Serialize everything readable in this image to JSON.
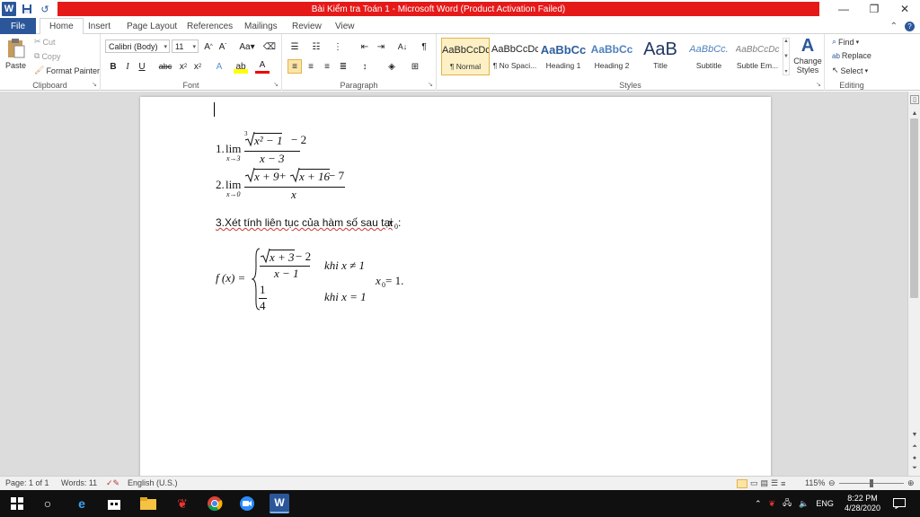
{
  "window": {
    "title": "Bài Kiểm tra Toán 1  -  Microsoft Word (Product Activation Failed)",
    "logo": "W",
    "minimize": "—",
    "restore": "❐",
    "close": "✕"
  },
  "tabs": [
    "File",
    "Home",
    "Insert",
    "Page Layout",
    "References",
    "Mailings",
    "Review",
    "View"
  ],
  "ribbon": {
    "clipboard": {
      "paste": "Paste",
      "cut": "Cut",
      "copy": "Copy",
      "format_painter": "Format Painter",
      "label": "Clipboard"
    },
    "font": {
      "name": "Calibri (Body)",
      "size": "11",
      "label": "Font"
    },
    "paragraph": {
      "label": "Paragraph"
    },
    "styles": {
      "label": "Styles",
      "items": [
        {
          "sample": "AaBbCcDc",
          "name": "¶ Normal"
        },
        {
          "sample": "AaBbCcDc",
          "name": "¶ No Spaci..."
        },
        {
          "sample": "AaBbCc",
          "name": "Heading 1"
        },
        {
          "sample": "AaBbCc",
          "name": "Heading 2"
        },
        {
          "sample": "AaB",
          "name": "Title"
        },
        {
          "sample": "AaBbCc.",
          "name": "Subtitle"
        },
        {
          "sample": "AaBbCcDc",
          "name": "Subtle Em..."
        }
      ],
      "change_styles": "Change Styles"
    },
    "editing": {
      "find": "Find",
      "replace": "Replace",
      "select": "Select",
      "label": "Editing"
    }
  },
  "document": {
    "p1_label": "1.",
    "p1_lim": "lim",
    "p1_sub": "x→3",
    "p1_num_root": "3",
    "p1_num_rad": "x² − 1",
    "p1_num_rest": " − 2",
    "p1_den": "x − 3",
    "p2_label": "2.",
    "p2_lim": "lim",
    "p2_sub": "x→0",
    "p2_num_a": "x + 9",
    "p2_plus": " + ",
    "p2_num_b": "x + 16",
    "p2_num_rest": " − 7",
    "p2_den": "x",
    "p3_text": "3.Xét tính liên tục của hàm số sau tại ",
    "p3_var": "x",
    "p3_var_sub": "0",
    "p3_colon": " :",
    "fx": "f (x) = ",
    "case1_num_rad": "x + 3",
    "case1_num_rest": " − 2",
    "case1_den": "x − 1",
    "case1_cond": "khi x ≠ 1",
    "case2_num": "1",
    "case2_den": "4",
    "case2_cond": "khi x = 1",
    "x0_var": "x",
    "x0_sub": "0",
    "x0_val": " = 1."
  },
  "status": {
    "page": "Page: 1 of 1",
    "words": "Words: 11",
    "language": "English (U.S.)",
    "zoom": "115%"
  },
  "taskbar": {
    "language": "ENG",
    "time": "8:22 PM",
    "date": "4/28/2020"
  }
}
